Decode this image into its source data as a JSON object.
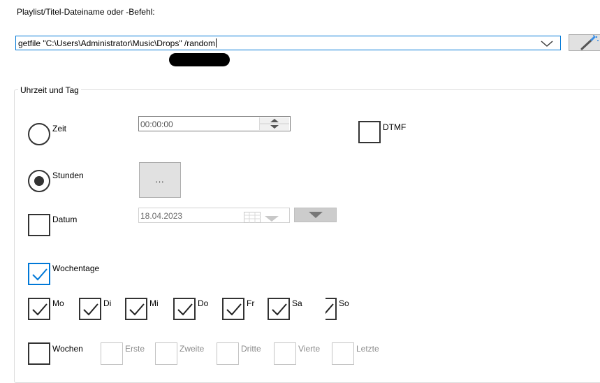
{
  "header": {
    "label": "Playlist/Titel-Dateiname oder -Befehl:"
  },
  "command": {
    "value": "getfile \"C:\\Users\\Administrator\\Music\\Drops\" /random"
  },
  "group": {
    "title": "Uhrzeit und Tag",
    "zeit": {
      "label": "Zeit",
      "value": "00:00:00"
    },
    "dtmf": {
      "label": "DTMF"
    },
    "stunden": {
      "label": "Stunden",
      "button": "..."
    },
    "datum": {
      "label": "Datum",
      "value": "18.04.2023"
    },
    "wochentage": {
      "label": "Wochentage"
    },
    "days": [
      {
        "label": "Mo",
        "checked": true
      },
      {
        "label": "Di",
        "checked": true
      },
      {
        "label": "Mi",
        "checked": true
      },
      {
        "label": "Do",
        "checked": true
      },
      {
        "label": "Fr",
        "checked": true
      },
      {
        "label": "Sa",
        "checked": true
      },
      {
        "label": "So",
        "checked": true
      }
    ],
    "wochen": {
      "label": "Wochen"
    },
    "weeks": [
      "Erste",
      "Zweite",
      "Dritte",
      "Vierte",
      "Letzte"
    ]
  },
  "colors": {
    "accent": "#0078d7",
    "border": "#333333",
    "disabled_text": "#8a8a8a"
  }
}
